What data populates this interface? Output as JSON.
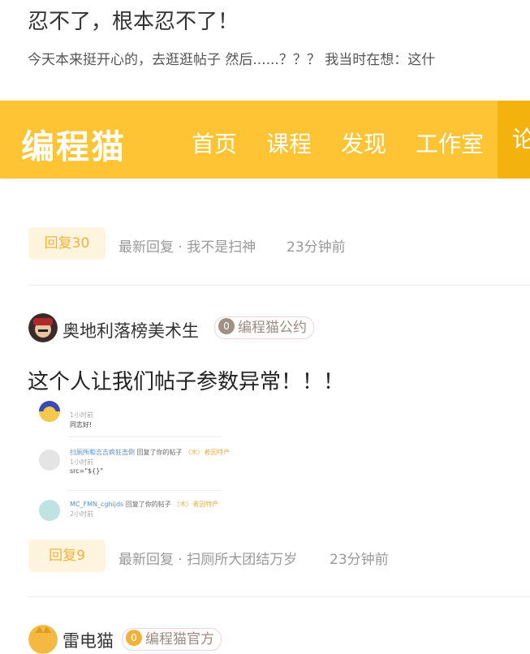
{
  "post1": {
    "title": "忍不了，根本忍不了！",
    "excerpt": "今天本来挺开心的，去逛逛帖子 然后......？？？ 我当时在想：这什",
    "reply_badge": "回复30",
    "latest_reply": "最新回复 · 我不是扫神",
    "time": "23分钟前"
  },
  "navbar": {
    "logo": "编程猫",
    "items": [
      "首页",
      "课程",
      "发现",
      "工作室",
      "论"
    ]
  },
  "post2": {
    "author": "奥地利落榜美术生",
    "tag": "编程猫公约",
    "tag_level": "0",
    "title": "这个人让我们帖子参数异常！！！",
    "reply_badge": "回复9",
    "latest_reply": "最新回复 · 扫厕所大团结万岁",
    "time": "23分钟前",
    "screenshot": {
      "rows": [
        {
          "time": "1小时前",
          "body": "同志好!"
        },
        {
          "name": "扫厕所和吉吉疯狂击倒",
          "action": "回复了你的帖子",
          "post": "（木）者因特产",
          "time": "1小时前",
          "body": "src=\"${}\""
        },
        {
          "name": "MC_FMN_cghijds",
          "action": "回复了你的帖子",
          "post": "（木）者因特产",
          "time": "2小时前"
        }
      ]
    }
  },
  "post3": {
    "author": "雷电猫",
    "tag": "编程猫官方",
    "tag_level": "0"
  },
  "colors": {
    "brand": "#fec433",
    "nav_active": "#f4b20e",
    "badge_bg": "#fff4de",
    "badge_text": "#f4b23a"
  }
}
